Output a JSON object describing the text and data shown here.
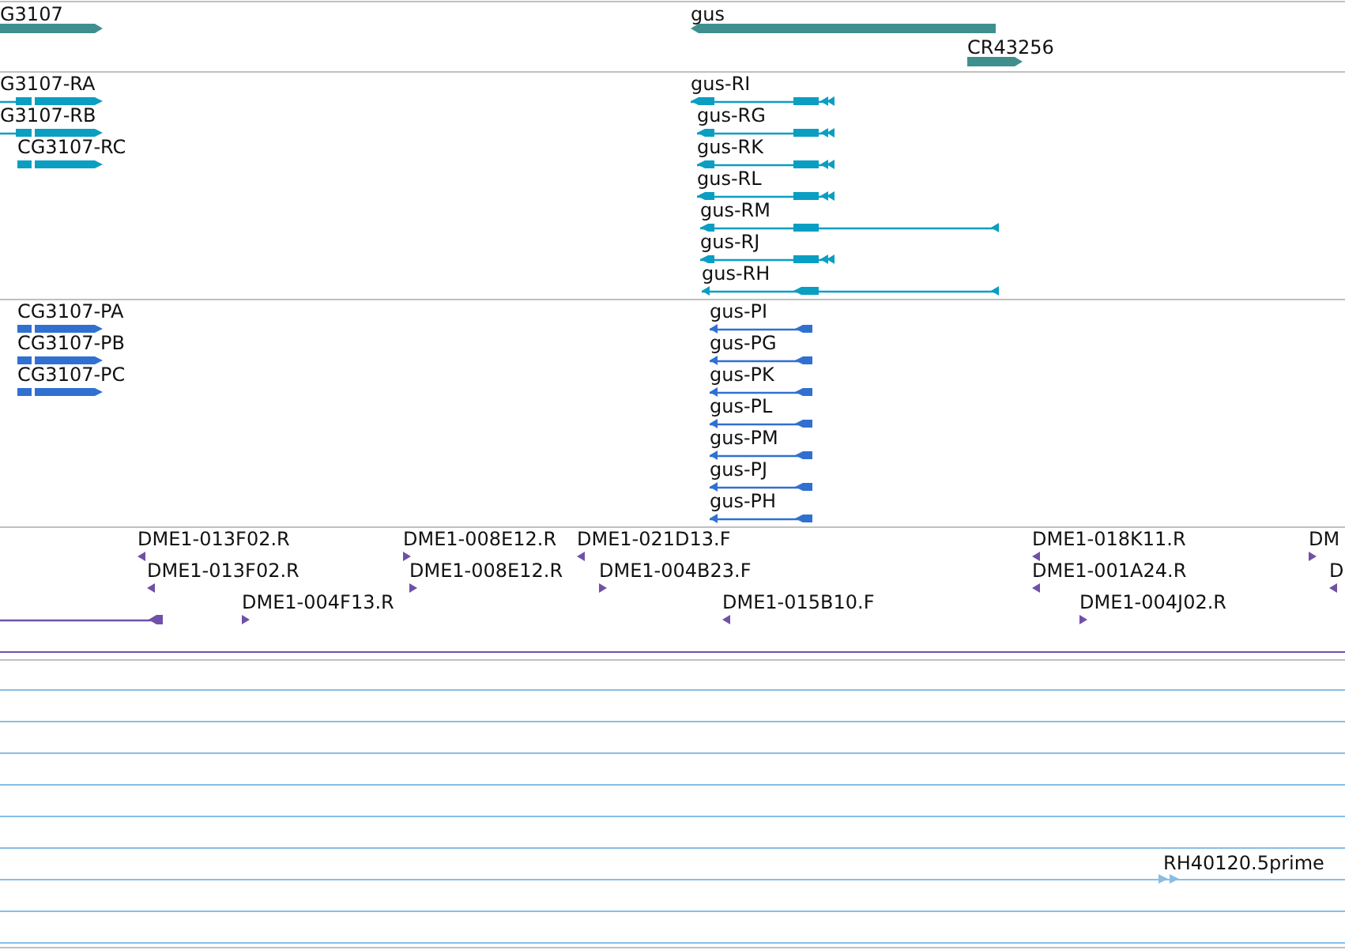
{
  "tracks": [
    {
      "kind": "gene",
      "features": [
        {
          "label": "G3107",
          "reverse": false
        },
        {
          "label": "gus",
          "reverse": true
        },
        {
          "label": "CR43256",
          "reverse": false
        }
      ]
    },
    {
      "kind": "transcript",
      "features": [
        {
          "label": "G3107-RA",
          "reverse": false
        },
        {
          "label": "G3107-RB",
          "reverse": false
        },
        {
          "label": "CG3107-RC",
          "reverse": false
        },
        {
          "label": "gus-RI",
          "reverse": true
        },
        {
          "label": "gus-RG",
          "reverse": true
        },
        {
          "label": "gus-RK",
          "reverse": true
        },
        {
          "label": "gus-RL",
          "reverse": true
        },
        {
          "label": "gus-RM",
          "reverse": true
        },
        {
          "label": "gus-RJ",
          "reverse": true
        },
        {
          "label": "gus-RH",
          "reverse": true
        }
      ]
    },
    {
      "kind": "protein",
      "features": [
        {
          "label": "CG3107-PA",
          "reverse": false
        },
        {
          "label": "CG3107-PB",
          "reverse": false
        },
        {
          "label": "CG3107-PC",
          "reverse": false
        },
        {
          "label": "gus-PI",
          "reverse": true
        },
        {
          "label": "gus-PG",
          "reverse": true
        },
        {
          "label": "gus-PK",
          "reverse": true
        },
        {
          "label": "gus-PL",
          "reverse": true
        },
        {
          "label": "gus-PM",
          "reverse": true
        },
        {
          "label": "gus-PJ",
          "reverse": true
        },
        {
          "label": "gus-PH",
          "reverse": true
        }
      ]
    },
    {
      "kind": "est",
      "features": [
        {
          "label": "DME1-013F02.R",
          "reverse": true
        },
        {
          "label": "DME1-013F02.R",
          "reverse": true
        },
        {
          "label": "DME1-004F13.R",
          "reverse": false
        },
        {
          "label": "DME1-008E12.R",
          "reverse": false
        },
        {
          "label": "DME1-008E12.R",
          "reverse": false
        },
        {
          "label": "DME1-021D13.F",
          "reverse": true
        },
        {
          "label": "DME1-004B23.F",
          "reverse": false
        },
        {
          "label": "DME1-015B10.F",
          "reverse": true
        },
        {
          "label": "DME1-018K11.R",
          "reverse": true
        },
        {
          "label": "DME1-001A24.R",
          "reverse": true
        },
        {
          "label": "DME1-004J02.R",
          "reverse": false
        },
        {
          "label": "DM",
          "reverse": false
        },
        {
          "label": "D",
          "reverse": true
        },
        {
          "reverse": true
        }
      ]
    },
    {
      "kind": "cdna",
      "features": [
        {
          "label": "RH40120.5prime",
          "reverse": false
        }
      ]
    }
  ]
}
